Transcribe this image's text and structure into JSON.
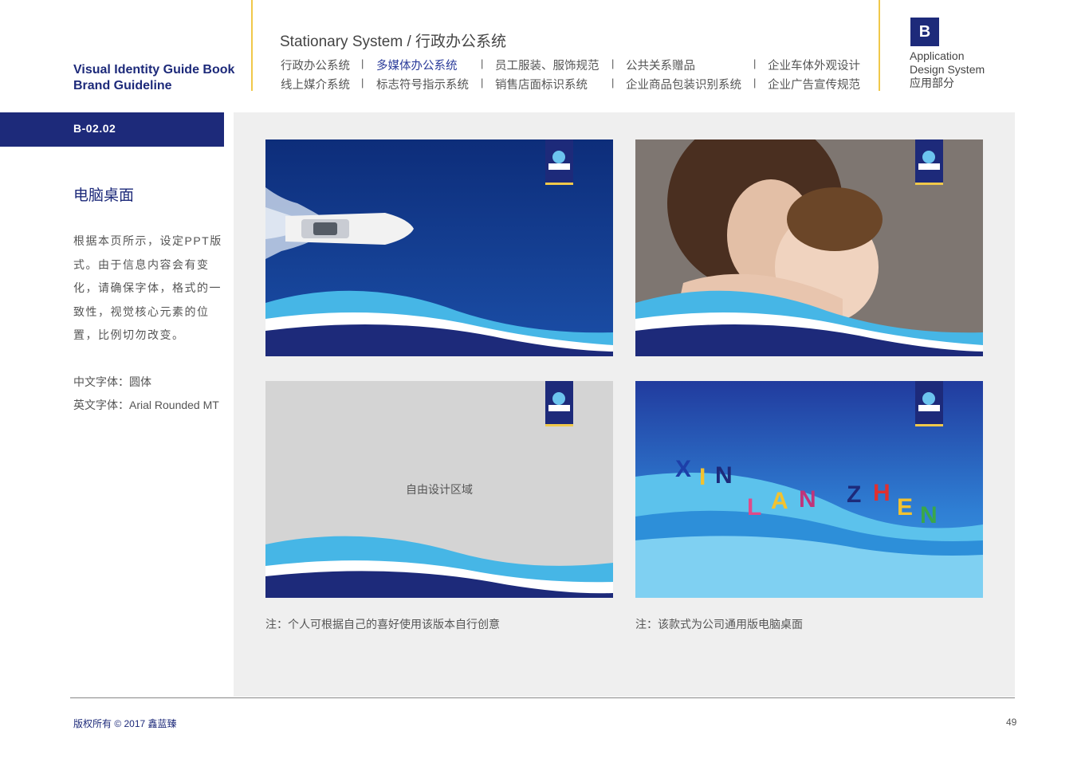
{
  "header": {
    "brand_line1": "Visual Identity Guide Book",
    "brand_line2": "Brand Guideline",
    "section_title": "Stationary System / 行政办公系统",
    "nav_row1": [
      "行政办公系统",
      "多媒体办公系统",
      "员工服装、服饰规范",
      "公共关系赠品",
      "企业车体外观设计"
    ],
    "nav_row2": [
      "线上媒介系统",
      "标志符号指示系统",
      "销售店面标识系统",
      "企业商品包装识别系统",
      "企业广告宣传规范"
    ],
    "separator": "|",
    "badge": "B",
    "app_line1": "Application",
    "app_line2": "Design System",
    "app_line3": "应用部分"
  },
  "sidebar": {
    "code": "B-02.02",
    "heading": "电脑桌面",
    "description": "根据本页所示，设定PPT版式。由于信息内容会有变化，请确保字体，格式的一致性，视觉核心元素的位置，比例切勿改变。",
    "font_cn": "中文字体：圆体",
    "font_en": "英文字体：Arial Rounded MT"
  },
  "cards": {
    "free_area_label": "自由设计区域",
    "letters": [
      "X",
      "I",
      "N",
      "L",
      "A",
      "N",
      "Z",
      "H",
      "E",
      "N"
    ]
  },
  "notes": {
    "left": "注：个人可根据自己的喜好使用该版本自行创意",
    "right": "注：该款式为公司通用版电脑桌面"
  },
  "footer": {
    "copyright": "版权所有 ©  2017  鑫蓝臻",
    "page_number": "49"
  },
  "colors": {
    "navy": "#1d2a7a",
    "gold": "#f0c84a",
    "panel_gray": "#efefef"
  }
}
